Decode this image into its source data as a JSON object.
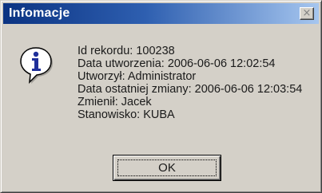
{
  "window": {
    "title": "Infomacje",
    "close_glyph": "×"
  },
  "icon": {
    "name": "information-icon",
    "glyph": "i",
    "color_fill": "#ffffff",
    "color_glyph": "#1f2f9a"
  },
  "message": {
    "lines": [
      "Id rekordu: 100238",
      "Data utworzenia: 2006-06-06 12:02:54",
      "Utworzył: Administrator",
      "Data ostatniej zmiany: 2006-06-06 12:03:54",
      "Zmienił: Jacek",
      "Stanowisko: KUBA"
    ]
  },
  "buttons": {
    "ok_label": "OK"
  }
}
